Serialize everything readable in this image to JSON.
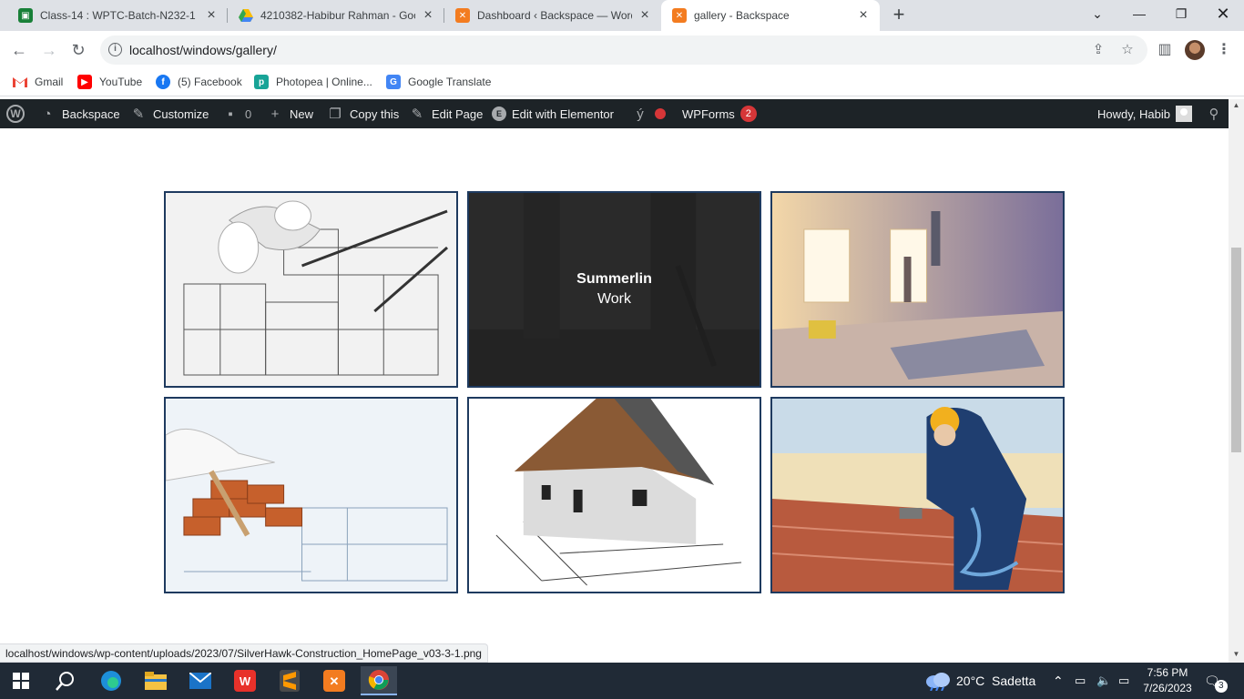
{
  "browser": {
    "tabs": [
      {
        "title": "Class-14 : WPTC-Batch-N232-1 -",
        "favicon": "classroom-icon",
        "color": "#188038"
      },
      {
        "title": "4210382-Habibur Rahman - Goo",
        "favicon": "google-drive-icon",
        "color": "#fbbc04"
      },
      {
        "title": "Dashboard ‹ Backspace — WordP",
        "favicon": "xampp-icon",
        "color": "#f37c20"
      },
      {
        "title": "gallery - Backspace",
        "favicon": "xampp-icon",
        "color": "#f37c20"
      }
    ],
    "url": "localhost/windows/gallery/",
    "bookmarks": [
      {
        "label": "Gmail",
        "icon": "gmail-icon"
      },
      {
        "label": "YouTube",
        "icon": "youtube-icon"
      },
      {
        "label": "(5) Facebook",
        "icon": "facebook-icon"
      },
      {
        "label": "Photopea | Online...",
        "icon": "photopea-icon"
      },
      {
        "label": "Google Translate",
        "icon": "google-translate-icon"
      }
    ]
  },
  "wpbar": {
    "site": "Backspace",
    "customize": "Customize",
    "comments": "0",
    "new": "New",
    "copy": "Copy this",
    "edit": "Edit Page",
    "elementor": "Edit with Elementor",
    "wpforms": "WPForms",
    "wpforms_count": "2",
    "howdy": "Howdy, Habib"
  },
  "gallery": {
    "hover_title": "Summerlin",
    "hover_subtitle": "Work"
  },
  "status_url": "localhost/windows/wp-content/uploads/2023/07/SilverHawk-Construction_HomePage_v03-3-1.png",
  "taskbar": {
    "weather": "20°C  Sadetta",
    "time": "7:56 PM",
    "date": "7/26/2023",
    "notifications": "3"
  }
}
